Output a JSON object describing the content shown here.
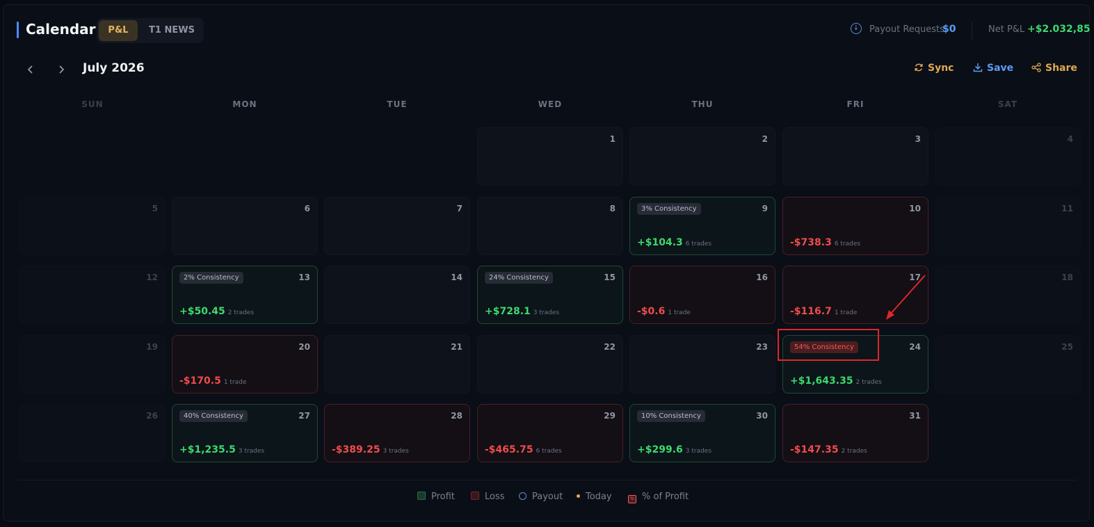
{
  "header": {
    "title": "Calendar",
    "tabs": [
      "P&L",
      "T1 NEWS"
    ],
    "payout_label": "Payout Requests",
    "payout_value": "$0",
    "net_label": "Net P&L",
    "net_value": "+$2.032,85"
  },
  "toolbar": {
    "month": "July 2026",
    "sync": "Sync",
    "save": "Save",
    "share": "Share"
  },
  "weekdays": [
    "SUN",
    "MON",
    "TUE",
    "WED",
    "THU",
    "FRI",
    "SAT"
  ],
  "days": {
    "d1": {
      "num": "1"
    },
    "d2": {
      "num": "2"
    },
    "d3": {
      "num": "3"
    },
    "d4": {
      "num": "4"
    },
    "d5": {
      "num": "5"
    },
    "d6": {
      "num": "6"
    },
    "d7": {
      "num": "7"
    },
    "d8": {
      "num": "8"
    },
    "d9": {
      "num": "9",
      "badge": "3% Consistency",
      "pnl": "+$104.3",
      "trades": "6 trades"
    },
    "d10": {
      "num": "10",
      "pnl": "-$738.3",
      "trades": "6 trades"
    },
    "d11": {
      "num": "11"
    },
    "d12": {
      "num": "12"
    },
    "d13": {
      "num": "13",
      "badge": "2% Consistency",
      "pnl": "+$50.45",
      "trades": "2 trades"
    },
    "d14": {
      "num": "14"
    },
    "d15": {
      "num": "15",
      "badge": "24% Consistency",
      "pnl": "+$728.1",
      "trades": "3 trades"
    },
    "d16": {
      "num": "16",
      "pnl": "-$0.6",
      "trades": "1 trade"
    },
    "d17": {
      "num": "17",
      "pnl": "-$116.7",
      "trades": "1 trade"
    },
    "d18": {
      "num": "18"
    },
    "d19": {
      "num": "19"
    },
    "d20": {
      "num": "20",
      "pnl": "-$170.5",
      "trades": "1 trade"
    },
    "d21": {
      "num": "21"
    },
    "d22": {
      "num": "22"
    },
    "d23": {
      "num": "23"
    },
    "d24": {
      "num": "24",
      "badge": "54% Consistency",
      "pnl": "+$1,643.35",
      "trades": "2 trades"
    },
    "d25": {
      "num": "25"
    },
    "d26": {
      "num": "26"
    },
    "d27": {
      "num": "27",
      "badge": "40% Consistency",
      "pnl": "+$1,235.5",
      "trades": "3 trades"
    },
    "d28": {
      "num": "28",
      "pnl": "-$389.25",
      "trades": "3 trades"
    },
    "d29": {
      "num": "29",
      "pnl": "-$465.75",
      "trades": "6 trades"
    },
    "d30": {
      "num": "30",
      "badge": "10% Consistency",
      "pnl": "+$299.6",
      "trades": "3 trades"
    },
    "d31": {
      "num": "31",
      "pnl": "-$147.35",
      "trades": "2 trades"
    }
  },
  "legend": {
    "profit": "Profit",
    "loss": "Loss",
    "payout": "Payout",
    "today": "Today",
    "pct": "% of Profit",
    "pct_glyph": "%"
  },
  "colors": {
    "accent": "#4a8cff",
    "profit": "#3ed86f",
    "loss": "#ef4c4c",
    "gold": "#e0a853"
  }
}
